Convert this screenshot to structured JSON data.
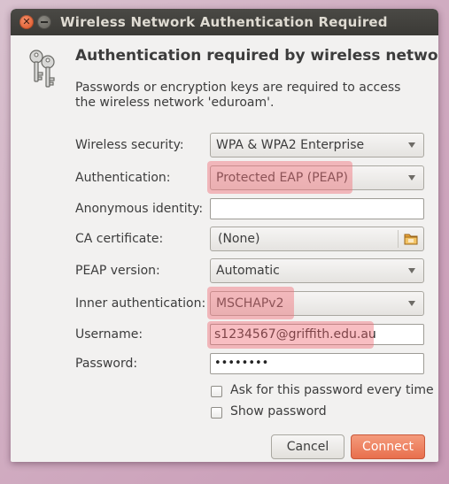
{
  "window": {
    "title": "Wireless Network Authentication Required"
  },
  "dialog": {
    "heading": "Authentication required by wireless network",
    "description": "Passwords or encryption keys are required to access the wireless network 'eduroam'."
  },
  "form": {
    "wireless_security": {
      "label": "Wireless security:",
      "value": "WPA & WPA2 Enterprise"
    },
    "authentication": {
      "label": "Authentication:",
      "value": "Protected EAP (PEAP)"
    },
    "anonymous_identity": {
      "label": "Anonymous identity:",
      "value": ""
    },
    "ca_certificate": {
      "label": "CA certificate:",
      "value": "(None)"
    },
    "peap_version": {
      "label": "PEAP version:",
      "value": "Automatic"
    },
    "inner_authentication": {
      "label": "Inner authentication:",
      "value": "MSCHAPv2"
    },
    "username": {
      "label": "Username:",
      "value": "s1234567@griffith.edu.au"
    },
    "password": {
      "label": "Password:",
      "value": "••••••••"
    },
    "ask_password": {
      "label": "Ask for this password every time"
    },
    "show_password": {
      "label": "Show password"
    }
  },
  "buttons": {
    "cancel": "Cancel",
    "connect": "Connect"
  },
  "icons": {
    "close": "close-icon",
    "minimize": "minimize-icon",
    "keys": "keys-icon",
    "folder": "folder-icon"
  },
  "colors": {
    "highlight": "#f06e78",
    "connect_button": "#e86f4d",
    "titlebar": "#3b3a36"
  }
}
